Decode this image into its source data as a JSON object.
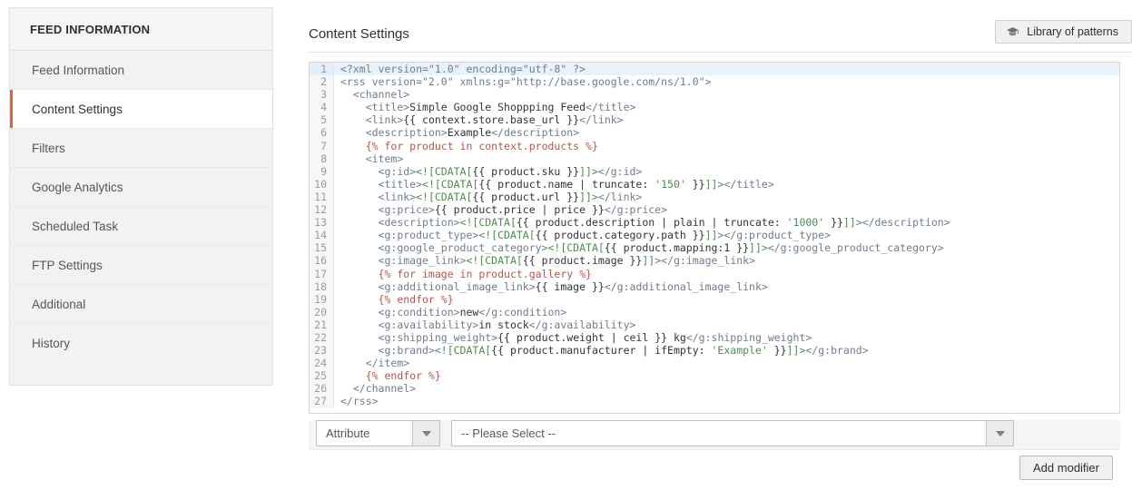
{
  "theme": {
    "accent": "#e0662c",
    "tag_color": "#6f7d8c",
    "string_color": "#4f8a4f",
    "twig_color": "#b5564a",
    "highlight_row": "#e8f2fb"
  },
  "sidebar": {
    "header": "FEED INFORMATION",
    "items": [
      {
        "label": "Feed Information",
        "active": false
      },
      {
        "label": "Content Settings",
        "active": true
      },
      {
        "label": "Filters",
        "active": false
      },
      {
        "label": "Google Analytics",
        "active": false
      },
      {
        "label": "Scheduled Task",
        "active": false
      },
      {
        "label": "FTP Settings",
        "active": false
      },
      {
        "label": "Additional",
        "active": false
      },
      {
        "label": "History",
        "active": false
      }
    ]
  },
  "main": {
    "title": "Content Settings",
    "library_button": {
      "label": "Library of patterns",
      "icon": "graduation-cap-icon"
    }
  },
  "editor": {
    "active_line": 1,
    "line_count": 27,
    "lines": [
      {
        "n": 1,
        "indent": 0,
        "tokens": [
          [
            "tag",
            "<?xml version=\"1.0\" encoding=\"utf-8\" ?>"
          ]
        ]
      },
      {
        "n": 2,
        "indent": 0,
        "tokens": [
          [
            "tag",
            "<rss version=\"2.0\" xmlns:g=\"http://base.google.com/ns/1.0\">"
          ]
        ]
      },
      {
        "n": 3,
        "indent": 1,
        "tokens": [
          [
            "tag",
            "<channel>"
          ]
        ]
      },
      {
        "n": 4,
        "indent": 2,
        "tokens": [
          [
            "tag",
            "<title>"
          ],
          [
            "txt",
            "Simple Google Shoppping Feed"
          ],
          [
            "tag",
            "</title>"
          ]
        ]
      },
      {
        "n": 5,
        "indent": 2,
        "tokens": [
          [
            "tag",
            "<link>"
          ],
          [
            "var",
            "{{ context.store.base_url }}"
          ],
          [
            "tag",
            "</link>"
          ]
        ]
      },
      {
        "n": 6,
        "indent": 2,
        "tokens": [
          [
            "tag",
            "<description>"
          ],
          [
            "txt",
            "Example"
          ],
          [
            "tag",
            "</description>"
          ]
        ]
      },
      {
        "n": 7,
        "indent": 2,
        "tokens": [
          [
            "twig",
            "{% for product in context.products %}"
          ]
        ]
      },
      {
        "n": 8,
        "indent": 2,
        "tokens": [
          [
            "tag",
            "<item>"
          ]
        ]
      },
      {
        "n": 9,
        "indent": 3,
        "tokens": [
          [
            "tag",
            "<g:id>"
          ],
          [
            "cdata",
            "<![CDATA["
          ],
          [
            "var",
            "{{ product.sku }}"
          ],
          [
            "cdata",
            "]]>"
          ],
          [
            "tag",
            "</g:id>"
          ]
        ]
      },
      {
        "n": 10,
        "indent": 3,
        "tokens": [
          [
            "tag",
            "<title>"
          ],
          [
            "cdata",
            "<![CDATA["
          ],
          [
            "var",
            "{{ product.name | truncate: "
          ],
          [
            "str",
            "'150'"
          ],
          [
            "var",
            " }}"
          ],
          [
            "cdata",
            "]]>"
          ],
          [
            "tag",
            "</title>"
          ]
        ]
      },
      {
        "n": 11,
        "indent": 3,
        "tokens": [
          [
            "tag",
            "<link>"
          ],
          [
            "cdata",
            "<![CDATA["
          ],
          [
            "var",
            "{{ product.url }}"
          ],
          [
            "cdata",
            "]]>"
          ],
          [
            "tag",
            "</link>"
          ]
        ]
      },
      {
        "n": 12,
        "indent": 3,
        "tokens": [
          [
            "tag",
            "<g:price>"
          ],
          [
            "var",
            "{{ product.price | price }}"
          ],
          [
            "tag",
            "</g:price>"
          ]
        ]
      },
      {
        "n": 13,
        "indent": 3,
        "tokens": [
          [
            "tag",
            "<description>"
          ],
          [
            "cdata",
            "<![CDATA["
          ],
          [
            "var",
            "{{ product.description | plain | truncate: "
          ],
          [
            "str",
            "'1000'"
          ],
          [
            "var",
            " }}"
          ],
          [
            "cdata",
            "]]>"
          ],
          [
            "tag",
            "</description>"
          ]
        ]
      },
      {
        "n": 14,
        "indent": 3,
        "tokens": [
          [
            "tag",
            "<g:product_type>"
          ],
          [
            "cdata",
            "<![CDATA["
          ],
          [
            "var",
            "{{ product.category.path }}"
          ],
          [
            "cdata",
            "]]>"
          ],
          [
            "tag",
            "</g:product_type>"
          ]
        ]
      },
      {
        "n": 15,
        "indent": 3,
        "tokens": [
          [
            "tag",
            "<g:google_product_category>"
          ],
          [
            "cdata",
            "<![CDATA["
          ],
          [
            "var",
            "{{ product.mapping:1 }}"
          ],
          [
            "cdata",
            "]]>"
          ],
          [
            "tag",
            "</g:google_product_category>"
          ]
        ]
      },
      {
        "n": 16,
        "indent": 3,
        "tokens": [
          [
            "tag",
            "<g:image_link>"
          ],
          [
            "cdata",
            "<![CDATA["
          ],
          [
            "var",
            "{{ product.image }}"
          ],
          [
            "cdata",
            "]]>"
          ],
          [
            "tag",
            "</g:image_link>"
          ]
        ]
      },
      {
        "n": 17,
        "indent": 3,
        "tokens": [
          [
            "twig",
            "{% for image in product.gallery %}"
          ]
        ]
      },
      {
        "n": 18,
        "indent": 3,
        "tokens": [
          [
            "tag",
            "<g:additional_image_link>"
          ],
          [
            "var",
            "{{ image }}"
          ],
          [
            "tag",
            "</g:additional_image_link>"
          ]
        ]
      },
      {
        "n": 19,
        "indent": 3,
        "tokens": [
          [
            "twig",
            "{% endfor %}"
          ]
        ]
      },
      {
        "n": 20,
        "indent": 3,
        "tokens": [
          [
            "tag",
            "<g:condition>"
          ],
          [
            "txt",
            "new"
          ],
          [
            "tag",
            "</g:condition>"
          ]
        ]
      },
      {
        "n": 21,
        "indent": 3,
        "tokens": [
          [
            "tag",
            "<g:availability>"
          ],
          [
            "txt",
            "in stock"
          ],
          [
            "tag",
            "</g:availability>"
          ]
        ]
      },
      {
        "n": 22,
        "indent": 3,
        "tokens": [
          [
            "tag",
            "<g:shipping_weight>"
          ],
          [
            "var",
            "{{ product.weight | ceil }}"
          ],
          [
            "txt",
            " kg"
          ],
          [
            "tag",
            "</g:shipping_weight>"
          ]
        ]
      },
      {
        "n": 23,
        "indent": 3,
        "tokens": [
          [
            "tag",
            "<g:brand>"
          ],
          [
            "cdata",
            "<![CDATA["
          ],
          [
            "var",
            "{{ product.manufacturer | ifEmpty: "
          ],
          [
            "str",
            "'Example'"
          ],
          [
            "var",
            " }}"
          ],
          [
            "cdata",
            "]]>"
          ],
          [
            "tag",
            "</g:brand>"
          ]
        ]
      },
      {
        "n": 24,
        "indent": 2,
        "tokens": [
          [
            "tag",
            "</item>"
          ]
        ]
      },
      {
        "n": 25,
        "indent": 2,
        "tokens": [
          [
            "twig",
            "{% endfor %}"
          ]
        ]
      },
      {
        "n": 26,
        "indent": 1,
        "tokens": [
          [
            "tag",
            "</channel>"
          ]
        ]
      },
      {
        "n": 27,
        "indent": 0,
        "tokens": [
          [
            "tag",
            "</rss>"
          ]
        ]
      }
    ]
  },
  "form": {
    "attribute_select": {
      "value": "Attribute",
      "icon": "chevron-down-icon"
    },
    "value_select": {
      "value": "-- Please Select --",
      "icon": "chevron-down-icon"
    },
    "add_modifier_button": "Add modifier"
  }
}
